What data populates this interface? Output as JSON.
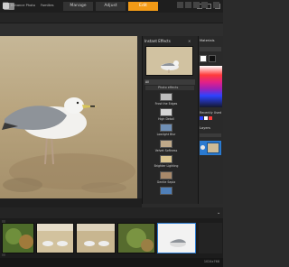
{
  "mode_tabs": {
    "manage": "Manage",
    "adjust": "Adjust",
    "edit": "Edit"
  },
  "breadcrumb": {
    "item1": "Enhance Photo",
    "item2": "Families"
  },
  "effects_panel": {
    "title": "Instant Effects",
    "filter_label": "All",
    "category_label": "Photo effects",
    "items": [
      {
        "label": "Frost the Edges"
      },
      {
        "label": "High Detail"
      },
      {
        "label": "Lowlight Blur"
      },
      {
        "label": "Velvet Softness"
      },
      {
        "label": "Brighter Lighting"
      },
      {
        "label": "Gentle Sepia"
      }
    ]
  },
  "right_panel": {
    "materials_label": "Materials",
    "recent_label": "Recently Used",
    "layers_label": "Layers"
  },
  "footer": {
    "text": "1024x768"
  },
  "colors": {
    "accent": "#f29a16",
    "selection": "#2a7ad0"
  }
}
